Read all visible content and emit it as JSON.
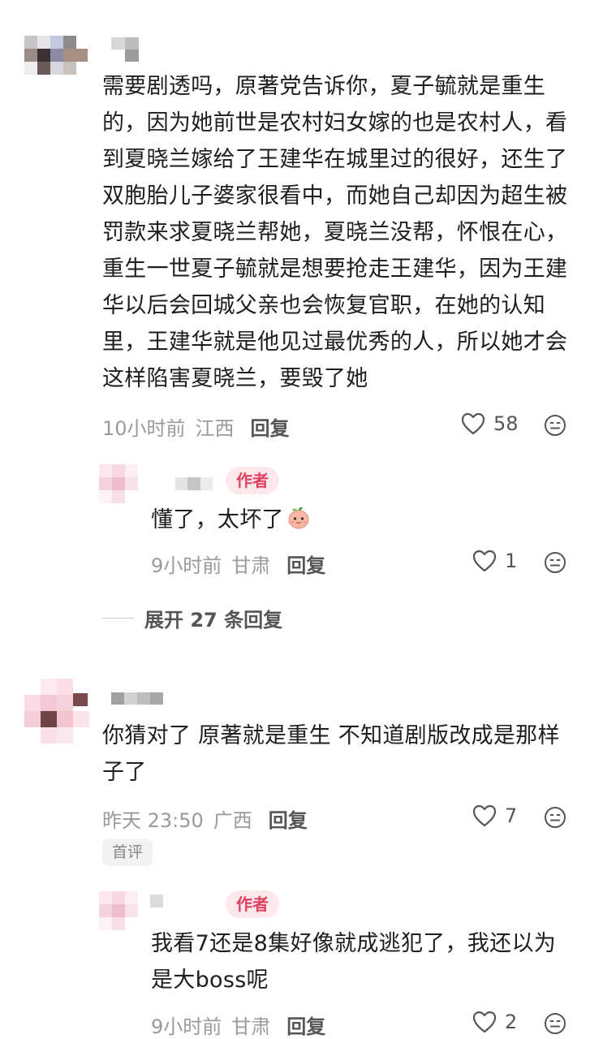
{
  "comments": [
    {
      "text": "需要剧透吗，原著党告诉你，夏子毓就是重生的，因为她前世是农村妇女嫁的也是农村人，看到夏晓兰嫁给了王建华在城里过的很好，还生了双胞胎儿子婆家很看中，而她自己却因为超生被罚款来求夏晓兰帮她，夏晓兰没帮，怀恨在心，重生一世夏子毓就是想要抢走王建华，因为王建华以后会回城父亲也会恢复官职，在她的认知里，王建华就是他见过最优秀的人，所以她才会这样陷害夏晓兰，要毁了她",
      "time": "10小时前",
      "location": "江西",
      "reply_label": "回复",
      "likes": "58",
      "reply": {
        "badge": "作者",
        "text": "懂了，太坏了",
        "emoji": "peach-face-emoji",
        "time": "9小时前",
        "location": "甘肃",
        "reply_label": "回复",
        "likes": "1"
      },
      "expand_label": "展开 27 条回复"
    },
    {
      "text": "你猜对了 原著就是重生 不知道剧版改成是那样子了",
      "time": "昨天 23:50",
      "location": "广西",
      "reply_label": "回复",
      "likes": "7",
      "badge": "首评",
      "reply": {
        "badge": "作者",
        "text": "我看7还是8集好像就成逃犯了，我还以为是大boss呢",
        "time": "9小时前",
        "location": "甘肃",
        "reply_label": "回复",
        "likes": "2"
      }
    }
  ],
  "icons": {
    "like": "heart-outline-icon",
    "emoji": "emoji-face-icon"
  },
  "colors": {
    "author_badge_bg": "#fde9ec",
    "author_badge_text": "#e0405f",
    "meta_text": "#9a9a9a"
  }
}
